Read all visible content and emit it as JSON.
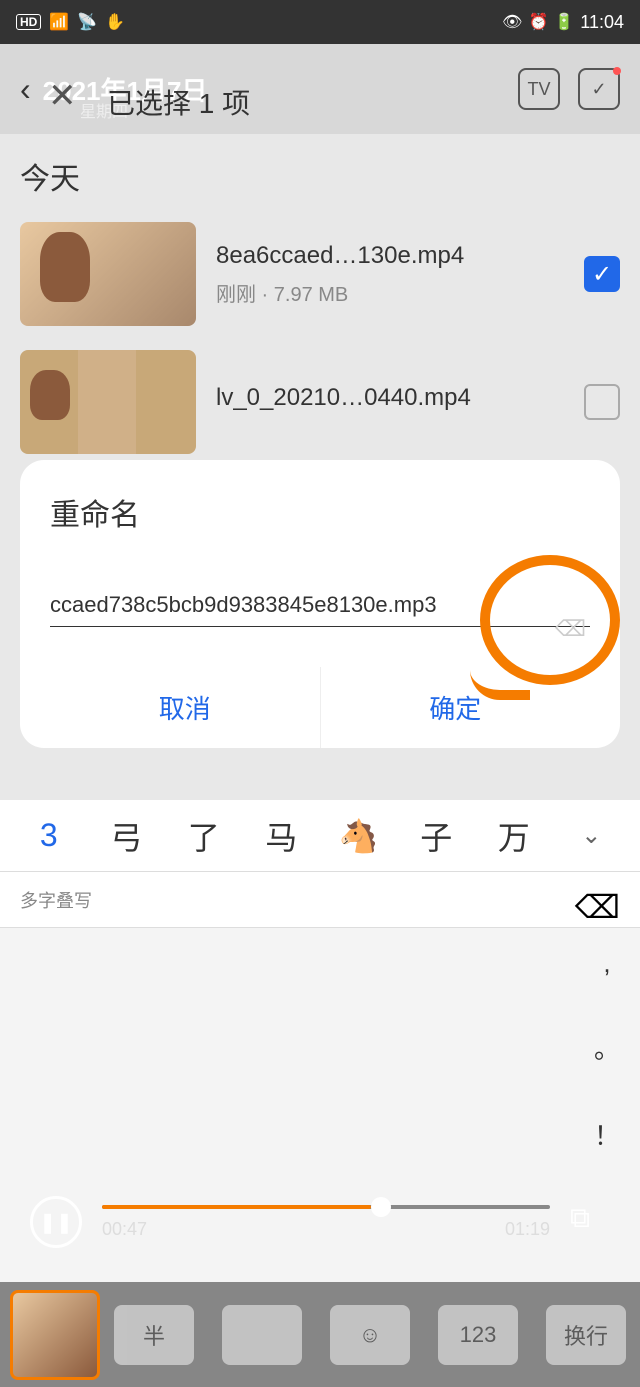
{
  "status": {
    "hd": "HD",
    "signal": "4G",
    "time": "11:04"
  },
  "header": {
    "date": "2021年1月7日",
    "weekday": "星期四",
    "selected": "已选择 1 项"
  },
  "section": {
    "today": "今天"
  },
  "files": [
    {
      "name": "8ea6ccaed…130e.mp4",
      "meta": "刚刚 · 7.97 MB",
      "checked": true
    },
    {
      "name": "lv_0_20210…0440.mp4",
      "meta": "",
      "checked": false
    }
  ],
  "dialog": {
    "title": "重命名",
    "input": "ccaed738c5bcb9d9383845e8130e.mp3",
    "cancel": "取消",
    "confirm": "确定"
  },
  "keyboard": {
    "candidates": [
      "3",
      "弓",
      "了",
      "马",
      "🐴",
      "子",
      "万"
    ],
    "hint": "多字叠写",
    "side": [
      ",",
      "。",
      "！"
    ]
  },
  "player": {
    "current": "00:47",
    "total": "01:19"
  },
  "bottom": {
    "keys": [
      "半",
      "",
      "☺",
      "123",
      "换行"
    ]
  }
}
